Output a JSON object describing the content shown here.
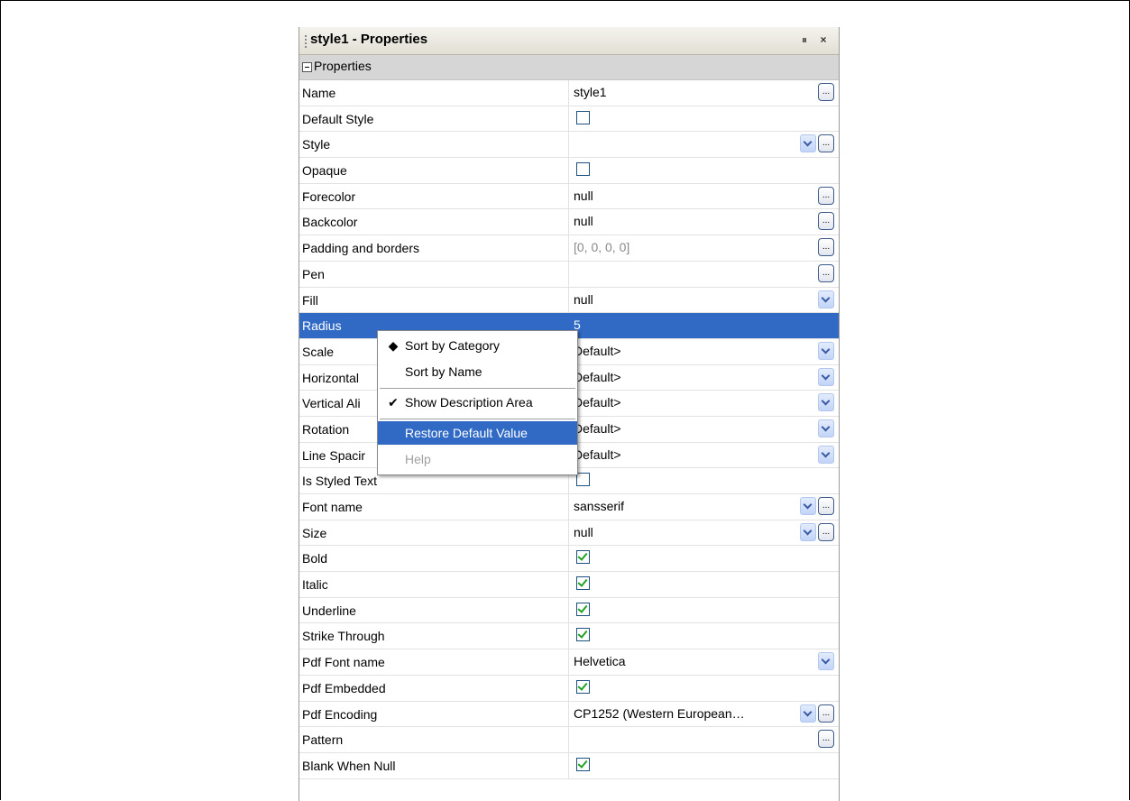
{
  "window": {
    "title": "style1 - Properties",
    "dock_icon": "dock-icon",
    "close_icon": "close-icon",
    "close_glyph": "×",
    "dock_glyph": "⏸"
  },
  "section": {
    "label": "Properties",
    "icon": "collapse-icon"
  },
  "rows": [
    {
      "name": "Name",
      "value": "style1",
      "control": "dots"
    },
    {
      "name": "Default Style",
      "control": "checkbox",
      "checked": false
    },
    {
      "name": "Style",
      "value": "",
      "control": "dropdown-dots"
    },
    {
      "name": "Opaque",
      "control": "checkbox",
      "checked": false
    },
    {
      "name": "Forecolor",
      "value": "null",
      "control": "dots"
    },
    {
      "name": "Backcolor",
      "value": "null",
      "control": "dots"
    },
    {
      "name": "Padding and borders",
      "value": "[0, 0, 0, 0]",
      "control": "dots",
      "muted": true
    },
    {
      "name": "Pen",
      "value": "",
      "control": "dots"
    },
    {
      "name": "Fill",
      "value": "null",
      "control": "dropdown"
    },
    {
      "name": "Radius",
      "value": "5",
      "control": "none",
      "selected": true
    },
    {
      "name": "Scale",
      "value": "Default>",
      "control": "dropdown"
    },
    {
      "name": "Horizontal",
      "value": "Default>",
      "control": "dropdown"
    },
    {
      "name": "Vertical Ali",
      "value": "Default>",
      "control": "dropdown"
    },
    {
      "name": "Rotation",
      "value": "Default>",
      "control": "dropdown"
    },
    {
      "name": "Line Spacir",
      "value": "Default>",
      "control": "dropdown"
    },
    {
      "name": "Is Styled Text",
      "control": "checkbox",
      "checked": false
    },
    {
      "name": "Font name",
      "value": "sansserif",
      "control": "dropdown-dots"
    },
    {
      "name": "Size",
      "value": "null",
      "control": "dropdown-dots"
    },
    {
      "name": "Bold",
      "control": "checkbox",
      "checked": true
    },
    {
      "name": "Italic",
      "control": "checkbox",
      "checked": true
    },
    {
      "name": "Underline",
      "control": "checkbox",
      "checked": true
    },
    {
      "name": "Strike Through",
      "control": "checkbox",
      "checked": true
    },
    {
      "name": "Pdf Font name",
      "value": "Helvetica",
      "control": "dropdown"
    },
    {
      "name": "Pdf Embedded",
      "control": "checkbox",
      "checked": true
    },
    {
      "name": "Pdf Encoding",
      "value": "CP1252 (Western European…",
      "control": "dropdown-dots"
    },
    {
      "name": "Pattern",
      "value": "",
      "control": "dots"
    },
    {
      "name": "Blank When Null",
      "control": "checkbox",
      "checked": true
    }
  ],
  "context_menu": {
    "items": [
      {
        "label": "Sort by Category",
        "mark": "◆",
        "state": "normal"
      },
      {
        "label": "Sort by Name",
        "mark": "",
        "state": "normal"
      },
      {
        "separator": true
      },
      {
        "label": "Show Description Area",
        "mark": "✔",
        "state": "normal"
      },
      {
        "separator": true
      },
      {
        "label": "Restore Default Value",
        "mark": "",
        "state": "highlighted"
      },
      {
        "label": "Help",
        "mark": "",
        "state": "disabled"
      }
    ]
  },
  "colors": {
    "selection": "#316ac5",
    "section_bg": "#d6d6d6",
    "check_green": "#21a121"
  },
  "glyphs": {
    "dots_button": "..."
  }
}
